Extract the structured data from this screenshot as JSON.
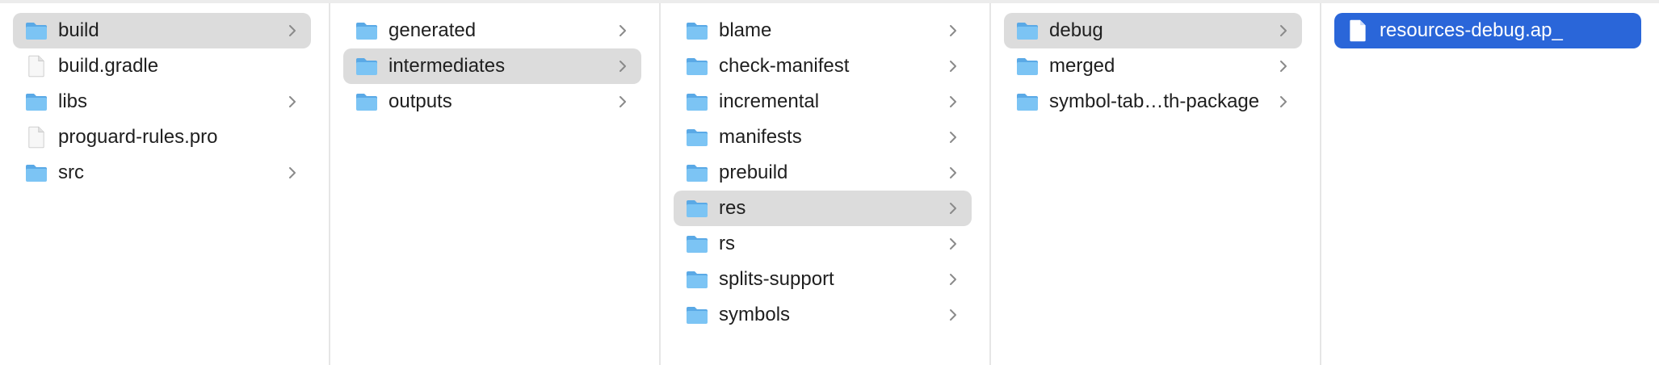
{
  "columns": [
    {
      "items": [
        {
          "label": "build",
          "kind": "folder",
          "expandable": true,
          "state": "path"
        },
        {
          "label": "build.gradle",
          "kind": "file",
          "expandable": false,
          "state": ""
        },
        {
          "label": "libs",
          "kind": "folder",
          "expandable": true,
          "state": ""
        },
        {
          "label": "proguard-rules.pro",
          "kind": "file",
          "expandable": false,
          "state": ""
        },
        {
          "label": "src",
          "kind": "folder",
          "expandable": true,
          "state": ""
        }
      ]
    },
    {
      "items": [
        {
          "label": "generated",
          "kind": "folder",
          "expandable": true,
          "state": ""
        },
        {
          "label": "intermediates",
          "kind": "folder",
          "expandable": true,
          "state": "path"
        },
        {
          "label": "outputs",
          "kind": "folder",
          "expandable": true,
          "state": ""
        }
      ]
    },
    {
      "items": [
        {
          "label": "blame",
          "kind": "folder",
          "expandable": true,
          "state": ""
        },
        {
          "label": "check-manifest",
          "kind": "folder",
          "expandable": true,
          "state": ""
        },
        {
          "label": "incremental",
          "kind": "folder",
          "expandable": true,
          "state": ""
        },
        {
          "label": "manifests",
          "kind": "folder",
          "expandable": true,
          "state": ""
        },
        {
          "label": "prebuild",
          "kind": "folder",
          "expandable": true,
          "state": ""
        },
        {
          "label": "res",
          "kind": "folder",
          "expandable": true,
          "state": "path"
        },
        {
          "label": "rs",
          "kind": "folder",
          "expandable": true,
          "state": ""
        },
        {
          "label": "splits-support",
          "kind": "folder",
          "expandable": true,
          "state": ""
        },
        {
          "label": "symbols",
          "kind": "folder",
          "expandable": true,
          "state": ""
        }
      ]
    },
    {
      "items": [
        {
          "label": "debug",
          "kind": "folder",
          "expandable": true,
          "state": "path"
        },
        {
          "label": "merged",
          "kind": "folder",
          "expandable": true,
          "state": ""
        },
        {
          "label": "symbol-tab…th-package",
          "kind": "folder",
          "expandable": true,
          "state": ""
        }
      ]
    },
    {
      "items": [
        {
          "label": "resources-debug.ap_",
          "kind": "file",
          "expandable": false,
          "state": "selected"
        }
      ]
    }
  ],
  "icons": {
    "folder": "folder-icon",
    "file": "file-icon",
    "chevron": "chevron-right-icon"
  },
  "colors": {
    "folder_fill": "#7cc4f4",
    "folder_tab": "#5aa9e6",
    "path_highlight": "#dcdcdc",
    "selection": "#2a66d9",
    "chevron": "#8a8a8a"
  }
}
